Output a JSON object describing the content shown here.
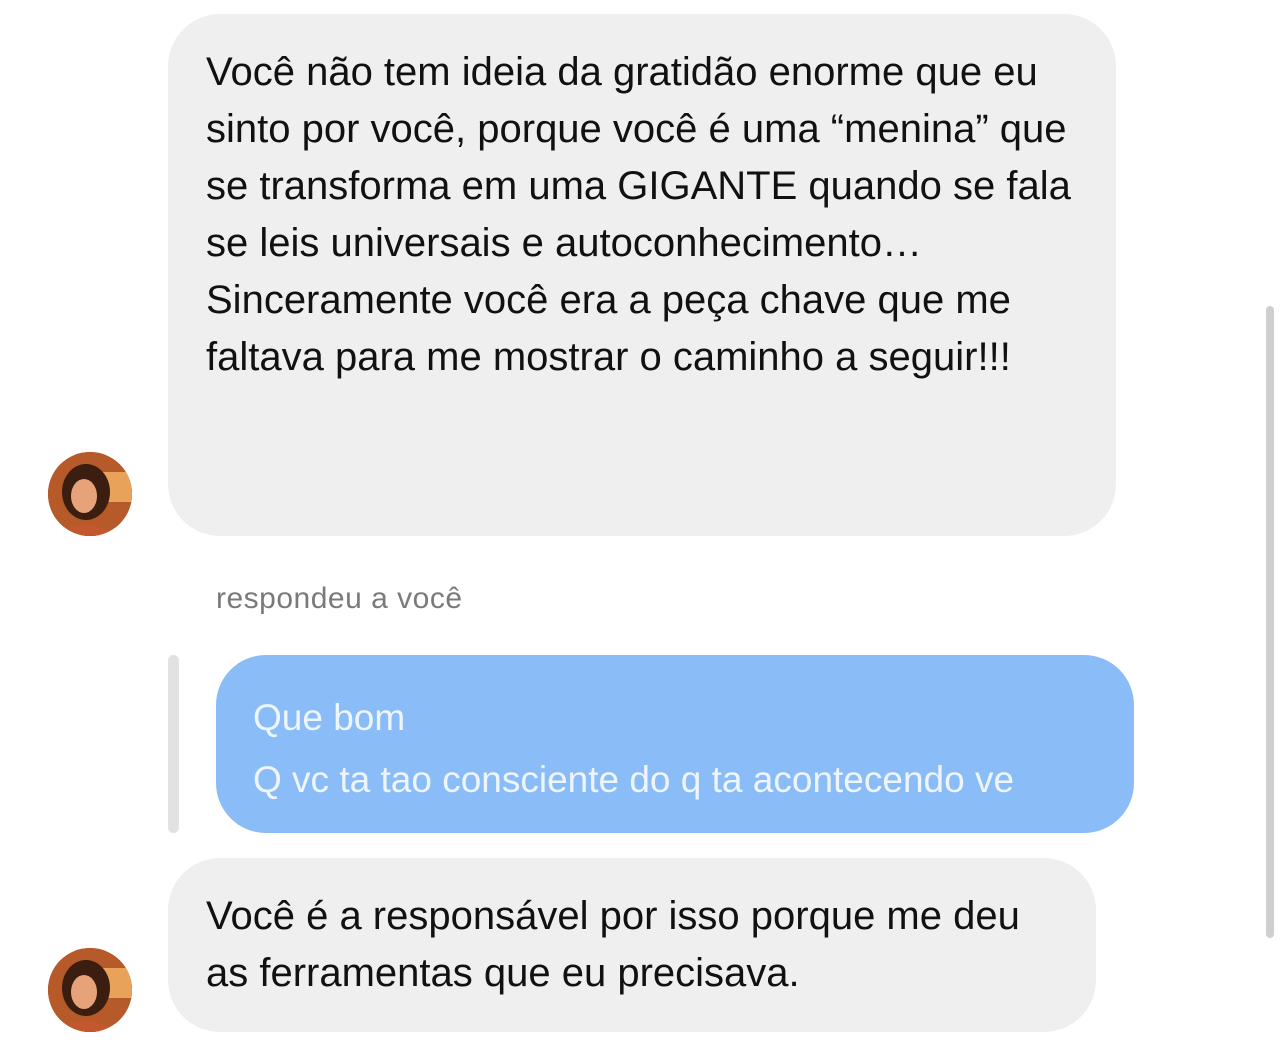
{
  "messages": [
    {
      "sender": "other",
      "avatar_icon": "user-avatar-photo-icon",
      "paragraphs": [
        "Você não tem ideia da gratidão enorme que eu sinto por você, porque você é uma “menina” que se transforma em uma GIGANTE quando se fala se leis universais e autoconhecimento…",
        "Sinceramente você era a peça chave que me faltava para me mostrar o caminho a seguir!!!"
      ]
    },
    {
      "reply_label": "respondeu a você",
      "quoted_lines": [
        "Que bom",
        "Q vc ta tao consciente do q ta acontecendo ve"
      ]
    },
    {
      "sender": "other",
      "avatar_icon": "user-avatar-photo-icon",
      "text": "Você é a responsável por isso porque me deu as ferramentas que eu precisava."
    }
  ],
  "colors": {
    "incoming_bubble": "#efefef",
    "quoted_bubble": "#8abdf7",
    "text": "#111111",
    "caption": "#7a7a7a"
  }
}
